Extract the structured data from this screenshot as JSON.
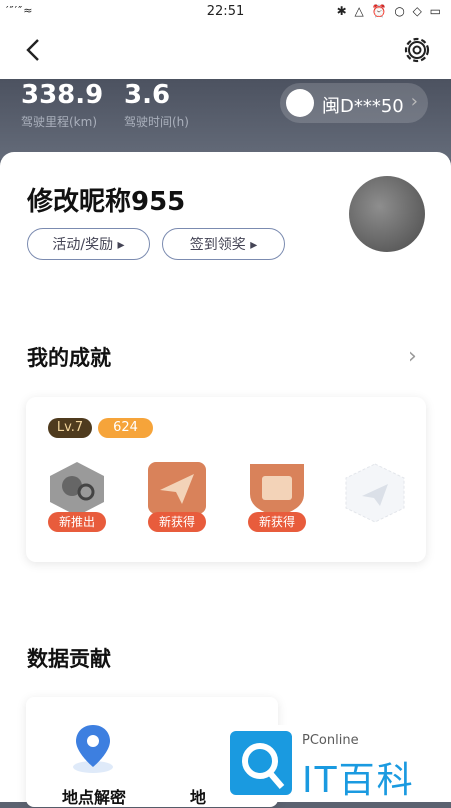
{
  "status_bar": {
    "signal": "′″′″≈",
    "time": "22:51",
    "icons": "✱ △ ⏰ ○ ◇ ▭"
  },
  "stats": [
    {
      "value": "338.9",
      "label": "驾驶里程(km)"
    },
    {
      "value": "3.6",
      "label": "驾驶时间(h)"
    }
  ],
  "plate": {
    "text": "闽D***50"
  },
  "profile": {
    "nickname": "修改昵称955",
    "buttons": [
      "活动/奖励 ▸",
      "签到领奖 ▸"
    ]
  },
  "achievements": {
    "title": "我的成就",
    "level": "Lv.7",
    "points": "624",
    "badges": [
      "新推出",
      "新获得",
      "新获得"
    ]
  },
  "data_section": {
    "title": "数据贡献",
    "items": [
      "地点解密",
      "地"
    ]
  },
  "watermark": {
    "small": "PConline",
    "big": "IT百科"
  },
  "colors": {
    "header_dark": "#5b6270",
    "badge_tag": "#e85c3c",
    "points": "#f6a43a",
    "level": "#4f3b1e",
    "brand": "#1a9ae0"
  }
}
